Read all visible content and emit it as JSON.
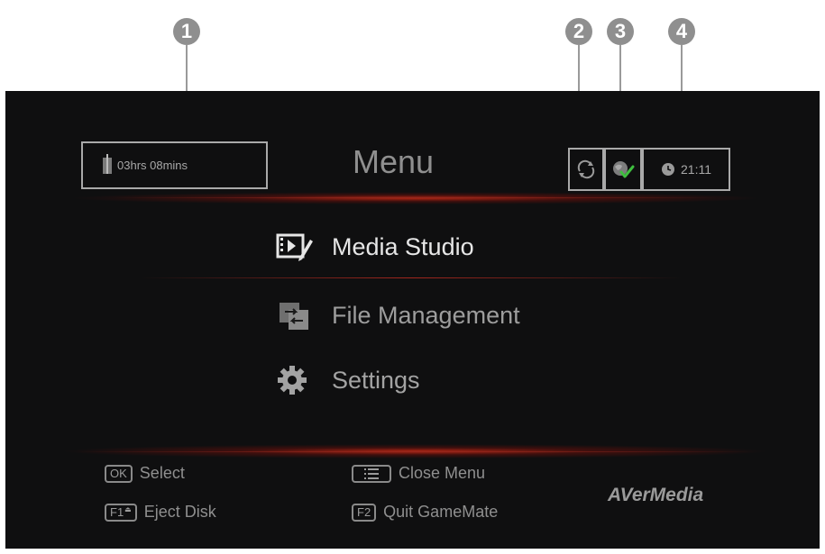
{
  "callouts": [
    "1",
    "2",
    "3",
    "4"
  ],
  "status_bar": {
    "record_time": "03hrs 08mins",
    "record_icon": "usb-drive-icon",
    "sync_icon": "sync-icon",
    "network_icon": "network-check-icon",
    "clock_icon": "clock-icon",
    "clock_time": "21:11"
  },
  "menu": {
    "title": "Menu",
    "items": [
      {
        "label": "Media Studio",
        "icon": "media-studio-icon",
        "selected": true
      },
      {
        "label": "File Management",
        "icon": "file-management-icon",
        "selected": false
      },
      {
        "label": "Settings",
        "icon": "gear-icon",
        "selected": false
      }
    ]
  },
  "hints": {
    "select": {
      "key": "OK",
      "label": "Select"
    },
    "eject": {
      "key": "F1",
      "label": "Eject Disk"
    },
    "close": {
      "key": "☰",
      "label": "Close Menu"
    },
    "quit": {
      "key": "F2",
      "label": "Quit GameMate"
    }
  },
  "brand": "AVerMedia",
  "colors": {
    "screen_bg": "#0f0f10",
    "accent_red": "#b0281e",
    "callout": "#8f8f8f",
    "check_green": "#3fbf3f"
  }
}
